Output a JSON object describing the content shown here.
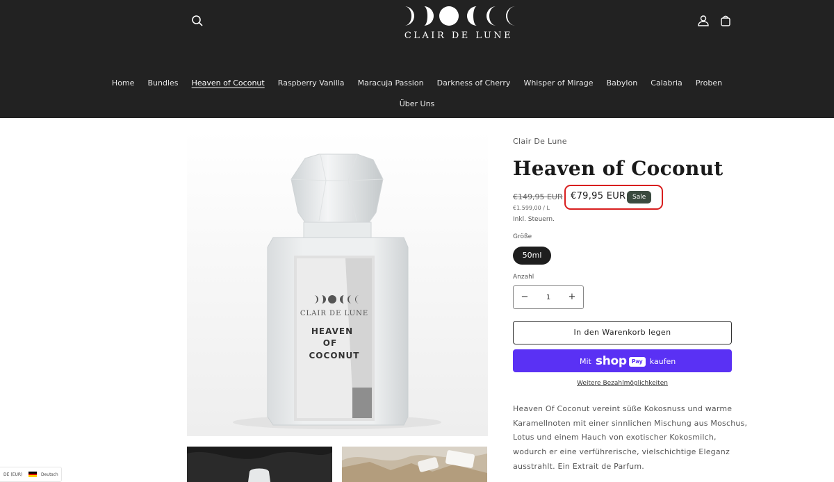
{
  "header": {
    "logo_text": "CLAIR DE LUNE",
    "icons": {
      "search": "search-icon",
      "account": "user-icon",
      "cart": "cart-icon"
    },
    "nav_row1": [
      "Home",
      "Bundles",
      "Heaven of Coconut",
      "Raspberry Vanilla",
      "Maracuja Passion",
      "Darkness of Cherry",
      "Whisper of Mirage",
      "Babylon",
      "Calabria",
      "Proben"
    ],
    "nav_row2": [
      "Über Uns"
    ],
    "active_nav": "Heaven of Coconut"
  },
  "gallery": {
    "bottle_label": {
      "brand": "CLAIR DE LUNE",
      "name_line1": "HEAVEN",
      "name_line2": "OF",
      "name_line3": "COCONUT"
    }
  },
  "product": {
    "vendor": "Clair De Lune",
    "title": "Heaven of Coconut",
    "price_old": "€149,95 EUR",
    "price_new": "€79,95 EUR",
    "sale_badge": "Sale",
    "unit_price": "€1.599,00 / L",
    "tax_note": "Inkl. Steuern.",
    "size_label": "Größe",
    "size_selected": "50ml",
    "quantity_label": "Anzahl",
    "quantity_value": "1",
    "quantity_minus": "−",
    "quantity_plus": "+",
    "add_to_cart": "In den Warenkorb legen",
    "shop_pay": {
      "prefix": "Mit",
      "brand": "shop",
      "pay": "Pay",
      "suffix": "kaufen"
    },
    "more_payment": "Weitere Bezahlmöglichkeiten",
    "description_lines": [
      "Heaven Of Coconut vereint süße Kokosnuss und warme",
      "Karamellnoten mit einer sinnlichen Mischung aus Moschus,",
      "Lotus und einem Hauch von exotischer Kokosmilch,",
      "wodurch er eine verführerische, vielschichtige Eleganz",
      "ausstrahlt. Ein Extrait de Parfum."
    ]
  },
  "locale": {
    "currency": "DE (EUR)",
    "language": "Deutsch",
    "flag_colors": [
      "#000000",
      "#dd0000",
      "#ffce00"
    ]
  },
  "colors": {
    "header_bg": "#222222",
    "sale_badge": "#3a4a3f",
    "shop_pay": "#5a31f4",
    "highlight": "#d81e1e"
  }
}
